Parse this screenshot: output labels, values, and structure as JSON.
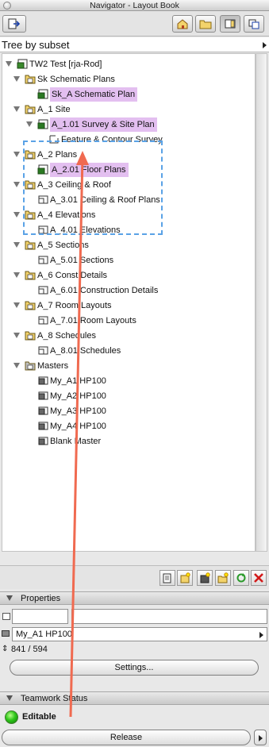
{
  "window": {
    "title": "Navigator - Layout Book"
  },
  "toolbar": {
    "buttons": [
      {
        "name": "project-map-button",
        "icon": "house-icon"
      },
      {
        "name": "view-map-button",
        "icon": "folder-icon"
      },
      {
        "name": "layout-book-button",
        "icon": "layout-icon",
        "active": true
      },
      {
        "name": "publisher-sets-button",
        "icon": "publisher-icon"
      }
    ],
    "left_menu_icon": "arrow-menu-icon"
  },
  "subset": {
    "label": "Tree by subset"
  },
  "tree": {
    "items": [
      {
        "label": "TW2 Test  [rja-Rod]",
        "level": 0,
        "expanded": true,
        "icon": "book-icon",
        "highlighted": false
      },
      {
        "label": "Sk Schematic Plans",
        "level": 1,
        "expanded": true,
        "icon": "subset-folder-icon",
        "highlighted": false
      },
      {
        "label": "Sk_A Schematic Plan",
        "level": 2,
        "expanded": null,
        "icon": "layout-green-icon",
        "highlighted": true
      },
      {
        "label": "A_1 Site",
        "level": 1,
        "expanded": true,
        "icon": "subset-folder-icon",
        "highlighted": false
      },
      {
        "label": "A_1.01 Survey & Site Plan",
        "level": 2,
        "expanded": true,
        "icon": "layout-green-icon",
        "highlighted": true
      },
      {
        "label": "Feature & Contour Survey",
        "level": 3,
        "expanded": null,
        "icon": "drawing-icon",
        "highlighted": false
      },
      {
        "label": "A_2 Plans",
        "level": 1,
        "expanded": true,
        "icon": "subset-folder-icon",
        "highlighted": false
      },
      {
        "label": "A_2.01 Floor Plans",
        "level": 2,
        "expanded": null,
        "icon": "layout-green-icon",
        "highlighted": true
      },
      {
        "label": "A_3 Ceiling & Roof",
        "level": 1,
        "expanded": true,
        "icon": "subset-folder-icon",
        "highlighted": false
      },
      {
        "label": "A_3.01 Ceiling & Roof Plans",
        "level": 2,
        "expanded": null,
        "icon": "layout-icon",
        "highlighted": false
      },
      {
        "label": "A_4 Elevations",
        "level": 1,
        "expanded": true,
        "icon": "subset-folder-icon",
        "highlighted": false
      },
      {
        "label": "A_4.01 Elevations",
        "level": 2,
        "expanded": null,
        "icon": "layout-icon",
        "highlighted": false
      },
      {
        "label": "A_5 Sections",
        "level": 1,
        "expanded": true,
        "icon": "subset-folder-icon",
        "highlighted": false
      },
      {
        "label": "A_5.01 Sections",
        "level": 2,
        "expanded": null,
        "icon": "layout-icon",
        "highlighted": false
      },
      {
        "label": "A_6 Const Details",
        "level": 1,
        "expanded": true,
        "icon": "subset-folder-icon",
        "highlighted": false
      },
      {
        "label": "A_6.01 Construction Details",
        "level": 2,
        "expanded": null,
        "icon": "layout-icon",
        "highlighted": false
      },
      {
        "label": "A_7 Room Layouts",
        "level": 1,
        "expanded": true,
        "icon": "subset-folder-icon",
        "highlighted": false
      },
      {
        "label": "A_7.01 Room Layouts",
        "level": 2,
        "expanded": null,
        "icon": "layout-icon",
        "highlighted": false
      },
      {
        "label": "A_8 Schedules",
        "level": 1,
        "expanded": true,
        "icon": "subset-folder-icon",
        "highlighted": false
      },
      {
        "label": "A_8.01 Schedules",
        "level": 2,
        "expanded": null,
        "icon": "layout-icon",
        "highlighted": false
      },
      {
        "label": "Masters",
        "level": 1,
        "expanded": true,
        "icon": "gray-folder-icon",
        "highlighted": false
      },
      {
        "label": "My_A1 HP100",
        "level": 2,
        "expanded": null,
        "icon": "master-icon",
        "highlighted": false
      },
      {
        "label": "My_A2 HP100",
        "level": 2,
        "expanded": null,
        "icon": "master-icon",
        "highlighted": false
      },
      {
        "label": "My_A3  HP100",
        "level": 2,
        "expanded": null,
        "icon": "master-icon",
        "highlighted": false
      },
      {
        "label": "My_A4  HP100",
        "level": 2,
        "expanded": null,
        "icon": "master-icon",
        "highlighted": false
      },
      {
        "label": "Blank Master",
        "level": 2,
        "expanded": null,
        "icon": "blank-master-icon",
        "highlighted": false
      }
    ]
  },
  "bottom_toolbar": {
    "buttons": [
      {
        "name": "new-layout-button",
        "icon": "new-layout-icon"
      },
      {
        "name": "new-subset-button",
        "icon": "new-subset-icon"
      },
      {
        "name": "new-master-button",
        "icon": "new-master-icon"
      },
      {
        "name": "new-folder-button",
        "icon": "new-folder-icon"
      },
      {
        "name": "refresh-button",
        "icon": "refresh-icon"
      },
      {
        "name": "delete-button",
        "icon": "delete-icon"
      }
    ]
  },
  "properties": {
    "heading": "Properties",
    "id_value": "",
    "name_value": "",
    "master_value": "My_A1 HP100",
    "size_text": "841 / 594",
    "settings_label": "Settings..."
  },
  "teamwork": {
    "heading": "Teamwork Status",
    "status": "Editable",
    "release_label": "Release"
  },
  "colors": {
    "highlight": "#e3bff0",
    "dashed_box": "#5aa2e6",
    "arrow": "#f06a50",
    "status_green": "#2fc71a"
  }
}
